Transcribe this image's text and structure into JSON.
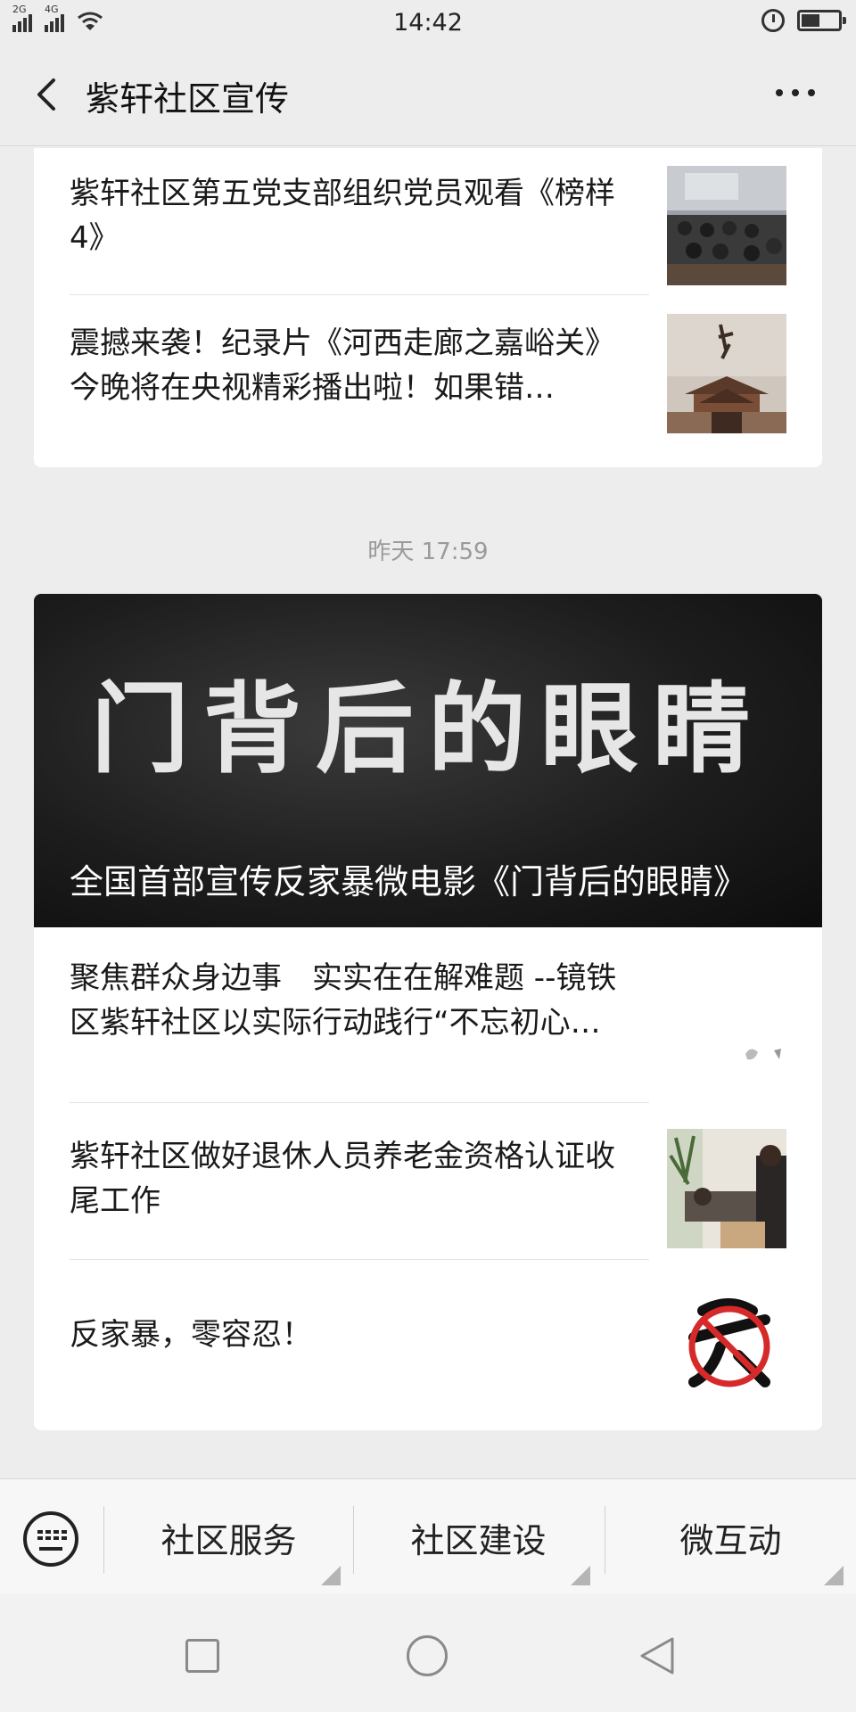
{
  "status_bar": {
    "time": "14:42",
    "signal1_tag": "2G",
    "signal2_tag": "4G"
  },
  "header": {
    "title": "紫轩社区宣传"
  },
  "group1": {
    "articles": [
      {
        "title": "紫轩社区第五党支部组织党员观看《榜样4》"
      },
      {
        "title": "震撼来袭！纪录片《河西走廊之嘉峪关》今晚将在央视精彩播出啦！如果错…"
      }
    ]
  },
  "timestamp": "昨天 17:59",
  "group2": {
    "hero_title": "全国首部宣传反家暴微电影《门背后的眼睛》",
    "hero_image_text": "门背后的眼睛",
    "articles": [
      {
        "title": "聚焦群众身边事　实实在在解难题 --镜铁区紫轩社区以实际行动践行“不忘初心…"
      },
      {
        "title": "紫轩社区做好退休人员养老金资格认证收尾工作"
      },
      {
        "title": "反家暴，零容忍！"
      }
    ]
  },
  "menu": {
    "items": [
      "社区服务",
      "社区建设",
      "微互动"
    ]
  },
  "icons": {
    "back": "chevron-left-icon",
    "more": "more-dots-icon",
    "keyboard": "keyboard-icon"
  }
}
